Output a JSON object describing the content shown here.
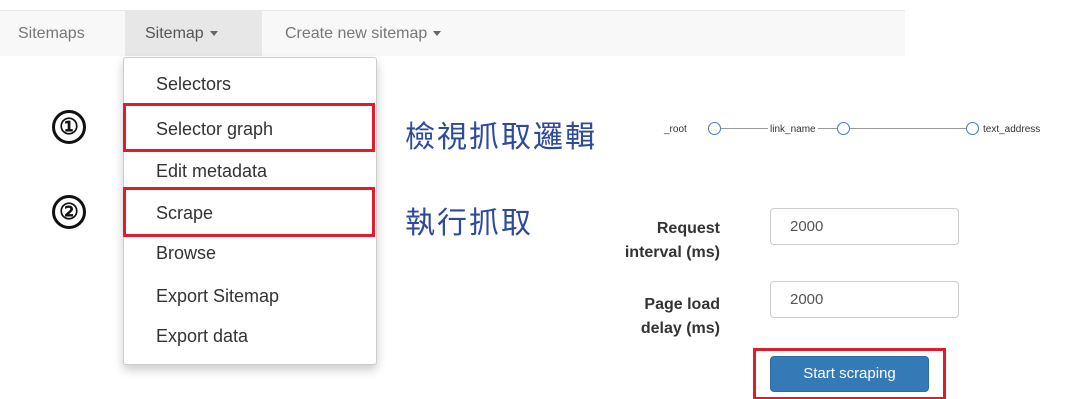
{
  "navbar": {
    "sitemaps": "Sitemaps",
    "sitemap": "Sitemap",
    "create_new": "Create new sitemap"
  },
  "dropdown": {
    "items": [
      "Selectors",
      "Selector graph",
      "Edit metadata",
      "Scrape",
      "Browse",
      "Export Sitemap",
      "Export data"
    ]
  },
  "annotations": {
    "step1_number": "①",
    "step1_text": "檢視抓取邏輯",
    "step2_number": "②",
    "step2_text": "執行抓取"
  },
  "graph": {
    "nodes": [
      "_root",
      "link_name",
      "text_address"
    ]
  },
  "form": {
    "request_interval_label": [
      "Request",
      "interval (ms)"
    ],
    "request_interval_value": "2000",
    "page_load_label": [
      "Page load",
      "delay (ms)"
    ],
    "page_load_value": "2000",
    "start_button": "Start scraping"
  },
  "colors": {
    "highlight": "#e21b2b",
    "primary_button": "#337ab7",
    "annotation_text": "#2e4a9a"
  }
}
